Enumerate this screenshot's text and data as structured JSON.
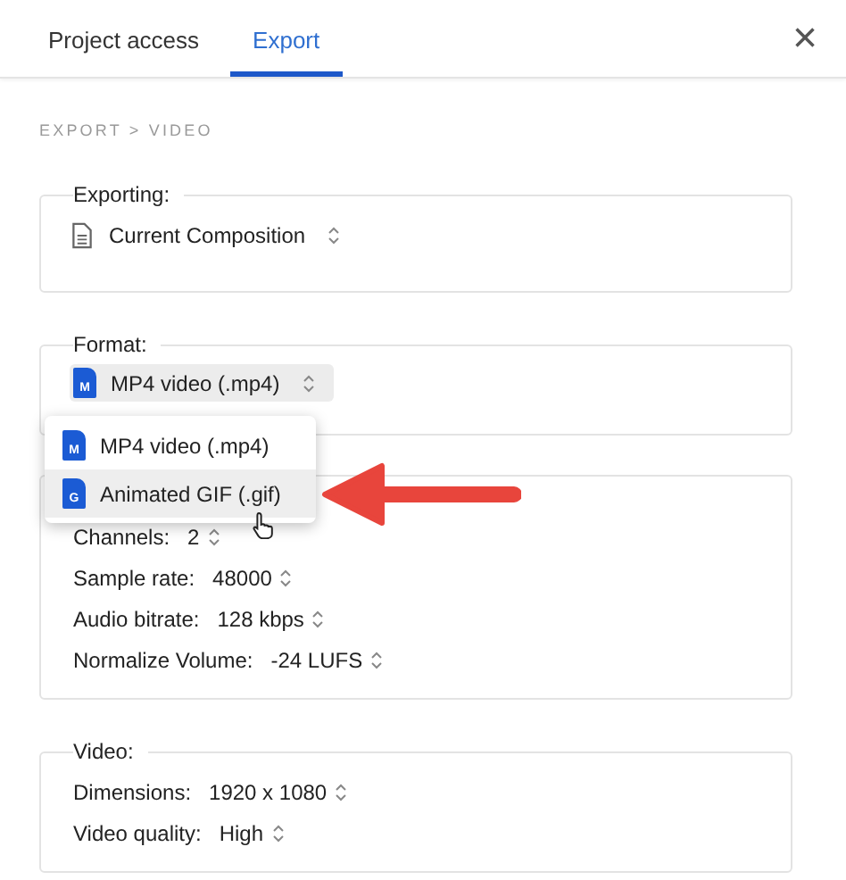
{
  "tabs": [
    {
      "label": "Project access",
      "selected": false
    },
    {
      "label": "Export",
      "selected": true
    }
  ],
  "close": "×",
  "breadcrumb": "EXPORT > VIDEO",
  "sections": [
    {
      "kind": "select",
      "legend": "Exporting:",
      "value": "Current Composition",
      "active": false
    },
    {
      "kind": "select",
      "legend": "Format:",
      "letter": "M",
      "value": "MP4 video (.mp4)",
      "active": true
    },
    {
      "kind": "settings",
      "rows": [
        {
          "label": "Channels:",
          "value": "2"
        },
        {
          "label": "Sample rate:",
          "value": "48000"
        },
        {
          "label": "Audio bitrate:",
          "value": "128 kbps"
        },
        {
          "label": "Normalize Volume:",
          "value": "-24 LUFS"
        }
      ]
    },
    {
      "kind": "settings",
      "legend": "Video:",
      "rows": [
        {
          "label": "Dimensions:",
          "value": "1920 x 1080"
        },
        {
          "label": "Video quality:",
          "value": "High"
        }
      ]
    }
  ],
  "dropdown": {
    "options": [
      {
        "letter": "M",
        "label": "MP4 video (.mp4)",
        "selected": false
      },
      {
        "letter": "G",
        "label": "Animated GIF (.gif)",
        "selected": true
      }
    ]
  }
}
